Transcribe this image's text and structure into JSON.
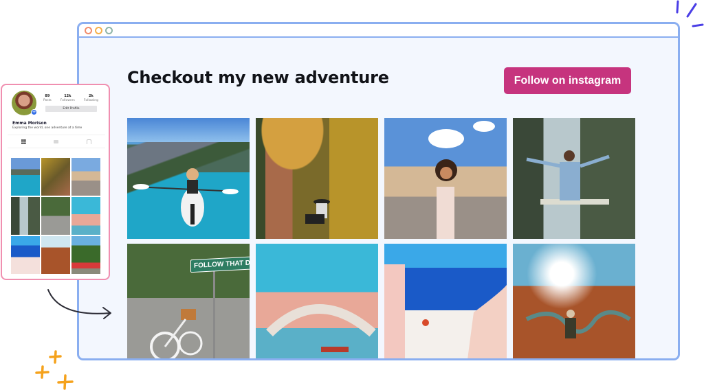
{
  "browser": {
    "window_controls": [
      "close",
      "minimize",
      "maximize"
    ]
  },
  "header": {
    "title": "Checkout my new adventure",
    "follow_button_label": "Follow on instagram"
  },
  "colors": {
    "accent": "#c6347e",
    "browser_border": "#8aaef0",
    "page_bg": "#f3f7fe",
    "phone_border": "#f08fb0",
    "sparkle_orange": "#f5a21c",
    "sparkle_purple": "#4a3ee6"
  },
  "gallery": {
    "photos": [
      {
        "subject": "kayak-lake-mountains"
      },
      {
        "subject": "woman-cliff-autumn-forest"
      },
      {
        "subject": "woman-st-peters-square"
      },
      {
        "subject": "woman-swing-waterfall"
      },
      {
        "subject": "bicycle-street-sign",
        "sign_text": "FOLLOW THAT DREAM"
      },
      {
        "subject": "venice-rialto-bridge"
      },
      {
        "subject": "santorini-stairs-sea"
      },
      {
        "subject": "hiker-horseshoe-canyon"
      }
    ]
  },
  "profile_card": {
    "name": "Emma Morison",
    "bio": "Exploring the world, one adventure at a time",
    "stats": [
      {
        "value": "89",
        "label": "Posts"
      },
      {
        "value": "12k",
        "label": "Followers"
      },
      {
        "value": "2k",
        "label": "Following"
      }
    ],
    "edit_button_label": "Edit Profile",
    "tabs": [
      "grid-icon",
      "reels-icon",
      "tagged-icon"
    ],
    "thumbnails": [
      {
        "subject": "kayak-lake"
      },
      {
        "subject": "woman-forest"
      },
      {
        "subject": "st-peters-square"
      },
      {
        "subject": "waterfall-swing"
      },
      {
        "subject": "bicycle-sign"
      },
      {
        "subject": "venice"
      },
      {
        "subject": "santorini"
      },
      {
        "subject": "canyon"
      },
      {
        "subject": "temple-gate-red-dress"
      }
    ]
  }
}
